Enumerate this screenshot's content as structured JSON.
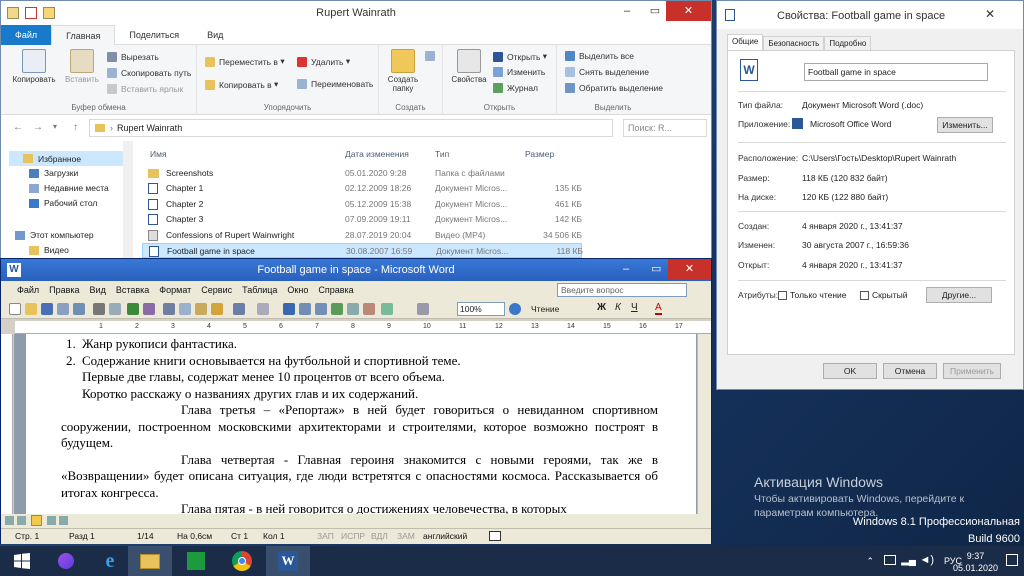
{
  "explorer": {
    "title": "Rupert Wainrath",
    "tabs": [
      "Файл",
      "Главная",
      "Поделиться",
      "Вид"
    ],
    "ribbon": {
      "copy": "Копировать",
      "paste": "Вставить",
      "cut": "Вырезать",
      "copy_path": "Скопировать путь",
      "paste_shortcut": "Вставить ярлык",
      "g_clipboard": "Буфер обмена",
      "move_to": "Переместить в",
      "copy_to": "Копировать в",
      "delete": "Удалить",
      "rename": "Переименовать",
      "g_organize": "Упорядочить",
      "new_folder": "Создать папку",
      "g_new": "Создать",
      "properties": "Свойства",
      "open": "Открыть",
      "edit": "Изменить",
      "history": "Журнал",
      "g_open": "Открыть",
      "select_all": "Выделить все",
      "select_none": "Снять выделение",
      "invert": "Обратить выделение",
      "g_select": "Выделить"
    },
    "address": "Rupert Wainrath",
    "search_placeholder": "Поиск: R...",
    "nav": {
      "favorites": "Избранное",
      "downloads": "Загрузки",
      "recent": "Недавние места",
      "desktop": "Рабочий стол",
      "this_pc": "Этот компьютер",
      "video": "Видео"
    },
    "columns": {
      "name": "Имя",
      "date": "Дата изменения",
      "type": "Тип",
      "size": "Размер"
    },
    "files": [
      {
        "name": "Screenshots",
        "date": "05.01.2020 9:28",
        "type": "Папка с файлами",
        "size": ""
      },
      {
        "name": "Chapter 1",
        "date": "02.12.2009 18:26",
        "type": "Документ Micros...",
        "size": "135 КБ"
      },
      {
        "name": "Chapter 2",
        "date": "05.12.2009 15:38",
        "type": "Документ Micros...",
        "size": "461 КБ"
      },
      {
        "name": "Chapter 3",
        "date": "07.09.2009 19:11",
        "type": "Документ Micros...",
        "size": "142 КБ"
      },
      {
        "name": "Confessions of Rupert Wainwright",
        "date": "28.07.2019 20:04",
        "type": "Видео (MP4)",
        "size": "34 506 КБ"
      },
      {
        "name": "Football game in space",
        "date": "30.08.2007 16:59",
        "type": "Документ Micros...",
        "size": "118 КБ"
      }
    ]
  },
  "props": {
    "title": "Свойства: Football game in space",
    "tabs": [
      "Общие",
      "Безопасность",
      "Подробно"
    ],
    "filename": "Football game in space",
    "type_label": "Тип файла:",
    "type_value": "Документ Microsoft Word (.doc)",
    "app_label": "Приложение:",
    "app_value": "Microsoft Office Word",
    "change_btn": "Изменить...",
    "loc_label": "Расположение:",
    "loc_value": "C:\\Users\\Гость\\Desktop\\Rupert Wainrath",
    "size_label": "Размер:",
    "size_value": "118 КБ (120 832 байт)",
    "disk_label": "На диске:",
    "disk_value": "120 КБ (122 880 байт)",
    "created_label": "Создан:",
    "created_value": "4 января 2020 г., 13:41:37",
    "modified_label": "Изменен:",
    "modified_value": "30 августа 2007 г., 16:59:36",
    "opened_label": "Открыт:",
    "opened_value": "4 января 2020 г., 13:41:37",
    "attr_label": "Атрибуты:",
    "readonly": "Только чтение",
    "hidden": "Скрытый",
    "other_btn": "Другие...",
    "ok": "OK",
    "cancel": "Отмена",
    "apply": "Применить"
  },
  "word": {
    "title": "Football game in space - Microsoft Word",
    "menu": [
      "Файл",
      "Правка",
      "Вид",
      "Вставка",
      "Формат",
      "Сервис",
      "Таблица",
      "Окно",
      "Справка"
    ],
    "help_placeholder": "Введите вопрос",
    "zoom": "100%",
    "reading": "Чтение",
    "doc": {
      "item1": "Жанр рукописи  фантастика.",
      "item2a": "Содержание книги основывается на футбольной и спортивной теме.",
      "item2b": "Первые две главы, содержат менее 10 процентов от всего объема.",
      "item2c": "Коротко расскажу о названиях  других глав и их содержаний.",
      "p1": "Глава третья – «Репортаж»  в ней будет говориться о невиданном спортивном сооружении, построенном московскими архитекторами и строителями, которое возможно построят в будущем.",
      "p2": "Глава  четвертая - Главная героиня знакомится с новыми героями, так же в  «Возвращении»  будет описана ситуация, где люди встретятся  с опасностями космоса. Рассказывается об итогах конгресса.",
      "p3": "Глава пятая - в ней говорится о достижениях человечества, в которых"
    },
    "status": {
      "page": "Стр. 1",
      "section": "Разд 1",
      "pages": "1/14",
      "at": "На 0,6см",
      "line": "Ст 1",
      "col": "Кол 1",
      "rec": "ЗАП",
      "trk": "ИСПР",
      "ext": "ВДЛ",
      "ovr": "ЗАМ",
      "lang": "английский"
    }
  },
  "activation": {
    "title": "Активация Windows",
    "text1": "Чтобы активировать Windows, перейдите к",
    "text2": "параметрам компьютера."
  },
  "edition": {
    "line1": "Windows 8.1 Профессиональная",
    "line2": "Build 9600"
  },
  "tray": {
    "lang": "РУС",
    "time": "9:37",
    "date": "05.01.2020"
  }
}
